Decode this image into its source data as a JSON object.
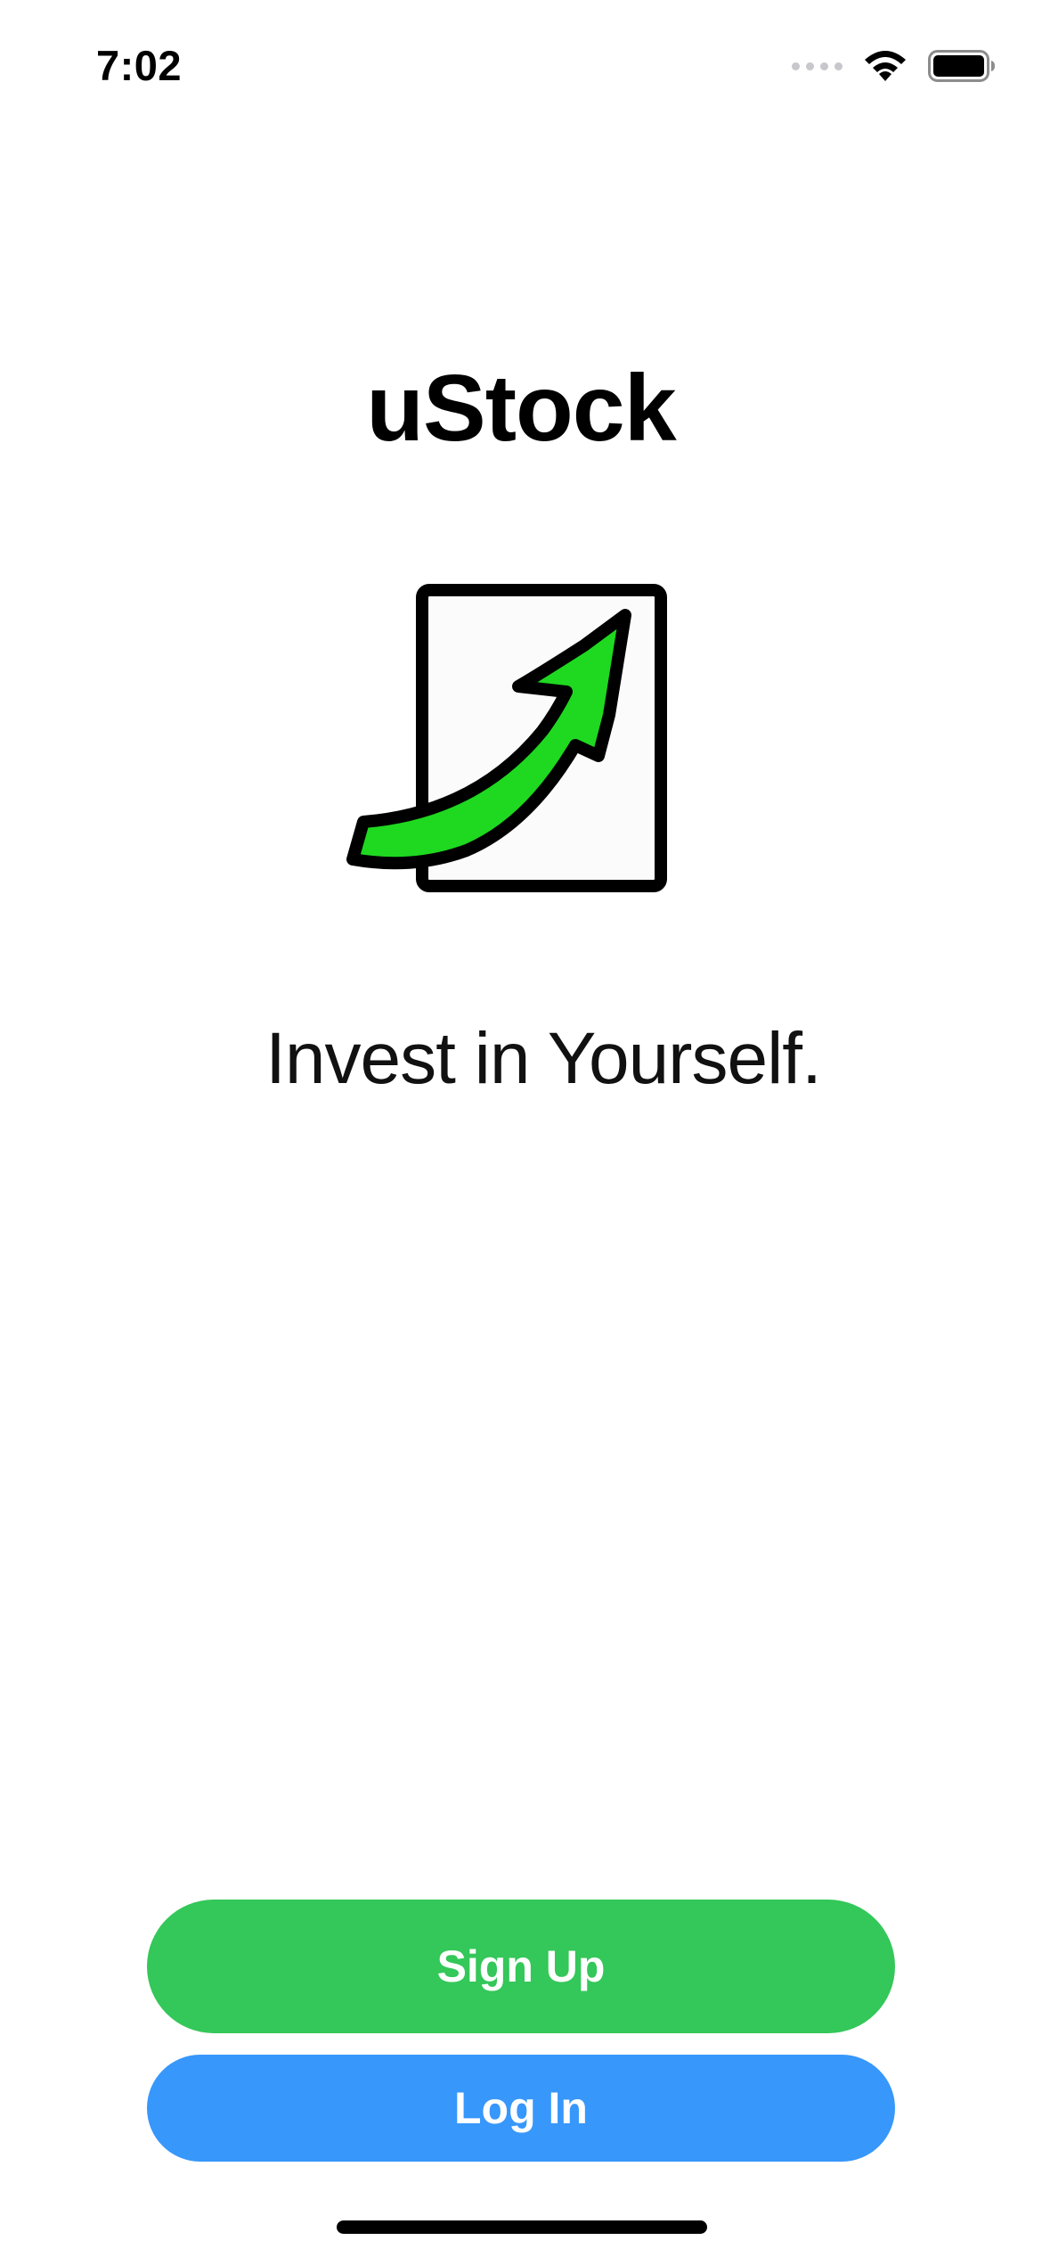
{
  "status_bar": {
    "time": "7:02",
    "icons": [
      "cellular-signal-icon",
      "wifi-icon",
      "battery-icon"
    ]
  },
  "app": {
    "title": "uStock",
    "logo": "rising-green-arrow-chart-logo",
    "tagline": "Invest in Yourself."
  },
  "actions": {
    "sign_up_label": "Sign Up",
    "log_in_label": "Log In"
  },
  "colors": {
    "sign_up_button": "#34c759",
    "log_in_button": "#3797fb",
    "arrow_green": "#1ed920",
    "background": "#ffffff",
    "text": "#000000"
  }
}
